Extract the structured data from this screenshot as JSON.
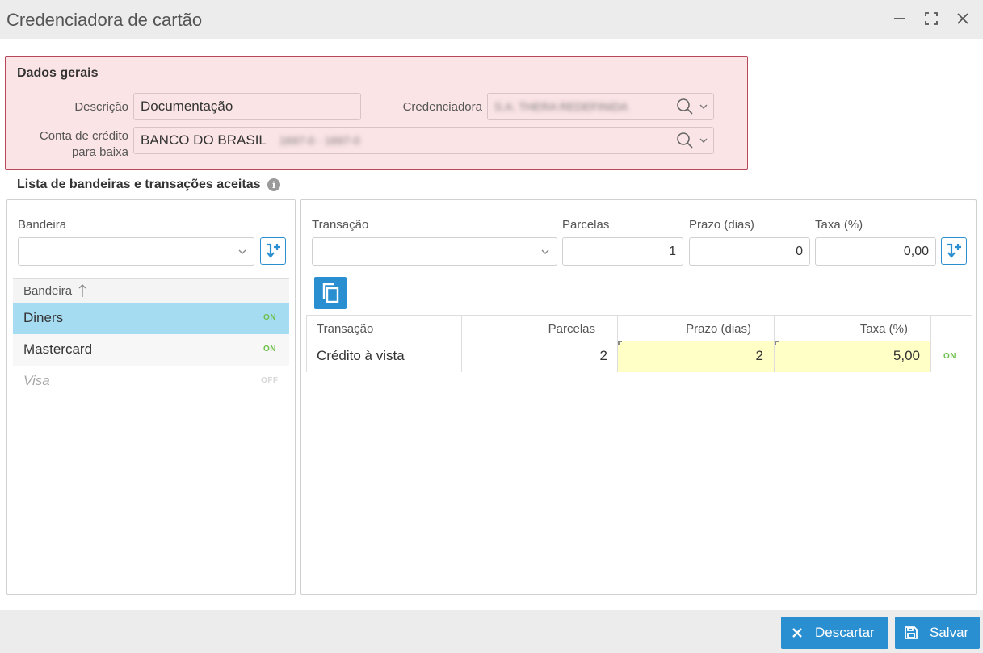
{
  "window": {
    "title": "Credenciadora de cartão",
    "controls": [
      "minimize-icon",
      "maximize-icon",
      "close-icon"
    ]
  },
  "general": {
    "section_title": "Dados gerais",
    "descricao_label": "Descrição",
    "descricao_value": "Documentação",
    "credenciadora_label": "Credenciadora",
    "credenciadora_value": "S.A. THERA REDEFINIDA",
    "conta_label_line1": "Conta de crédito",
    "conta_label_line2": "para baixa",
    "conta_value": "BANCO DO BRASIL",
    "conta_value_blurred": "1697-0 · 1697-0"
  },
  "list": {
    "title": "Lista de bandeiras e transações aceitas"
  },
  "bandeira_panel": {
    "label": "Bandeira",
    "select_value": "",
    "column_header": "Bandeira",
    "rows": [
      {
        "name": "Diners",
        "status": "ON",
        "selected": true
      },
      {
        "name": "Mastercard",
        "status": "ON",
        "selected": false
      },
      {
        "name": "Visa",
        "status": "OFF",
        "selected": false
      }
    ]
  },
  "transacao_panel": {
    "transacao_label": "Transação",
    "parcelas_label": "Parcelas",
    "prazo_label": "Prazo (dias)",
    "taxa_label": "Taxa (%)",
    "transacao_value": "",
    "parcelas_value": "1",
    "prazo_value": "0",
    "taxa_value": "0,00",
    "table": {
      "headers": [
        "Transação",
        "Parcelas",
        "Prazo (dias)",
        "Taxa (%)"
      ],
      "rows": [
        {
          "transacao": "Crédito à vista",
          "parcelas": "2",
          "prazo": "2",
          "taxa": "5,00",
          "status": "ON"
        }
      ]
    }
  },
  "footer": {
    "discard_label": "Descartar",
    "save_label": "Salvar"
  },
  "colors": {
    "accent": "#2a8fd1",
    "selected_row": "#a6dcf2",
    "edited_cell": "#ffffc6",
    "on_green": "#6cc04a",
    "general_bg": "#fbe4e6",
    "general_border": "#b8475a"
  }
}
